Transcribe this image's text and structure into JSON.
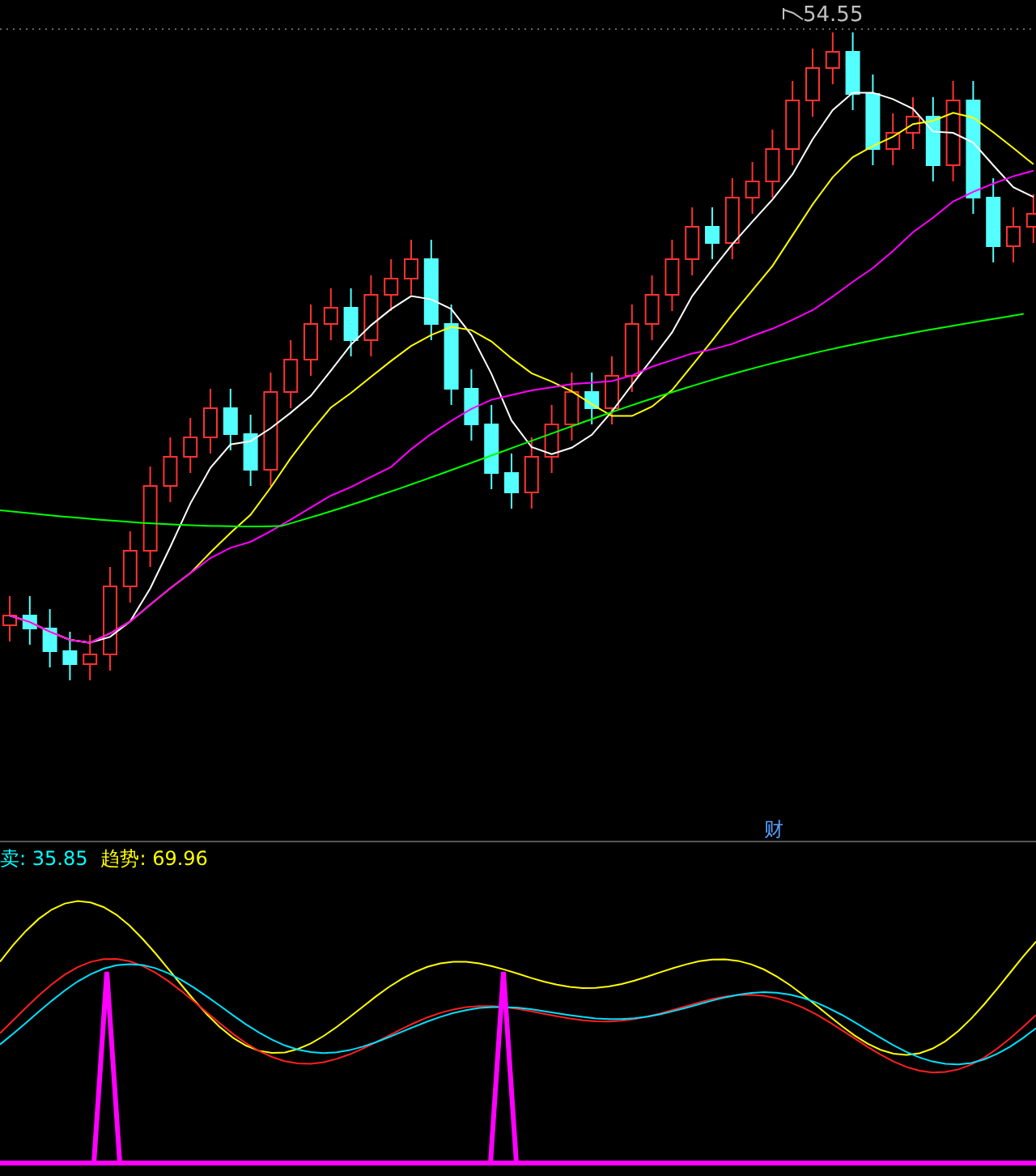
{
  "price_chart": {
    "high_label": "54.55",
    "event_badge": "财"
  },
  "indicator": {
    "legend": [
      {
        "label": "卖: 35.85",
        "color": "#00ffff"
      },
      {
        "label": "趋势: 69.96",
        "color": "#ffff00"
      }
    ]
  }
}
